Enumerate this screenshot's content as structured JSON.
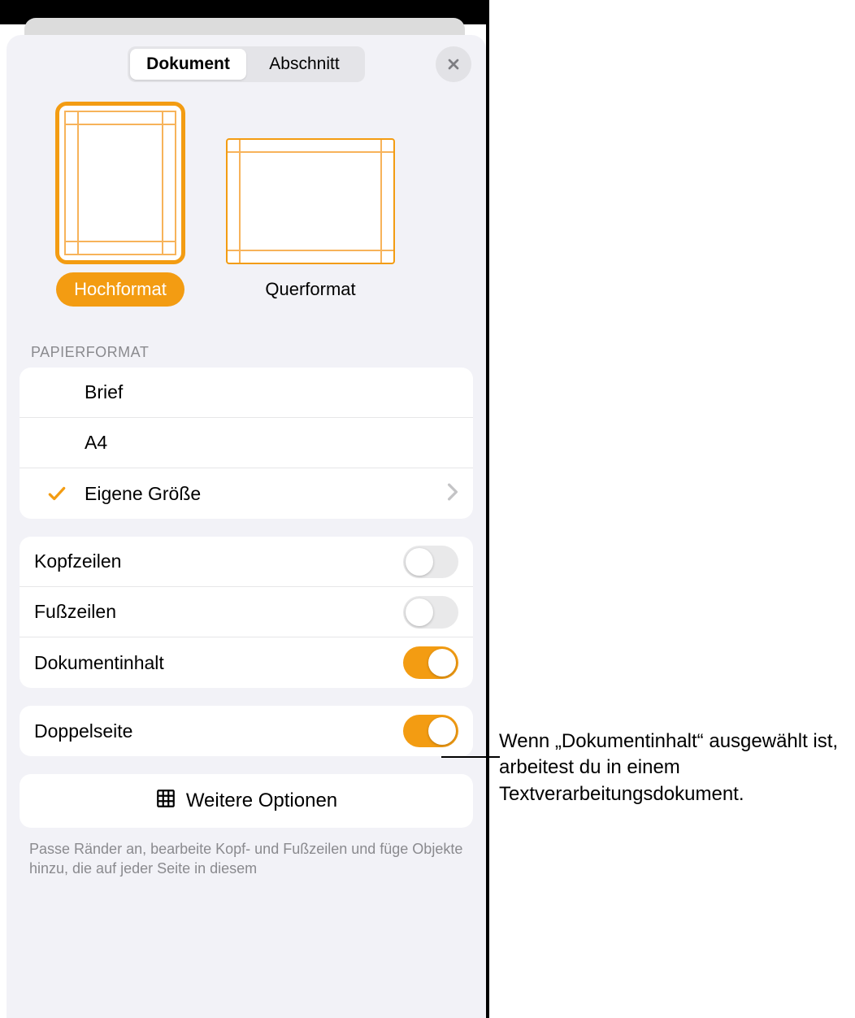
{
  "tabs": {
    "document": "Dokument",
    "section": "Abschnitt"
  },
  "orientation": {
    "portrait": "Hochformat",
    "landscape": "Querformat"
  },
  "paper": {
    "heading": "Papierformat",
    "letter": "Brief",
    "a4": "A4",
    "custom": "Eigene Größe"
  },
  "toggles": {
    "headers": "Kopfzeilen",
    "footers": "Fußzeilen",
    "body": "Dokumentinhalt",
    "facing": "Doppelseite"
  },
  "more": "Weitere Optionen",
  "footer_note": "Passe Ränder an, bearbeite Kopf- und Fußzeilen und füge Objekte hinzu, die auf jeder Seite in diesem",
  "callout": "Wenn „Dokumentinhalt“ ausgewählt ist, arbeitest du in einem Textverarbeitungsdokument."
}
